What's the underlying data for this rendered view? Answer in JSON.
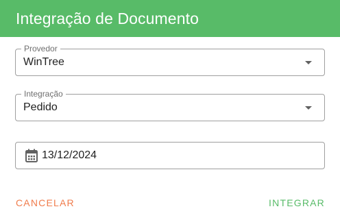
{
  "dialog": {
    "title": "Integração de Documento"
  },
  "provider": {
    "label": "Provedor",
    "value": "WinTree",
    "icon": "chevron-down-icon"
  },
  "integration": {
    "label": "Integração",
    "value": "Pedido",
    "icon": "chevron-down-icon"
  },
  "date": {
    "value": "13/12/2024",
    "icon": "calendar-icon"
  },
  "actions": {
    "cancel_label": "CANCELAR",
    "integrate_label": "INTEGRAR"
  },
  "colors": {
    "header_bg": "#58bb68",
    "cancel": "#f07c4c",
    "integrate": "#58bb68"
  }
}
